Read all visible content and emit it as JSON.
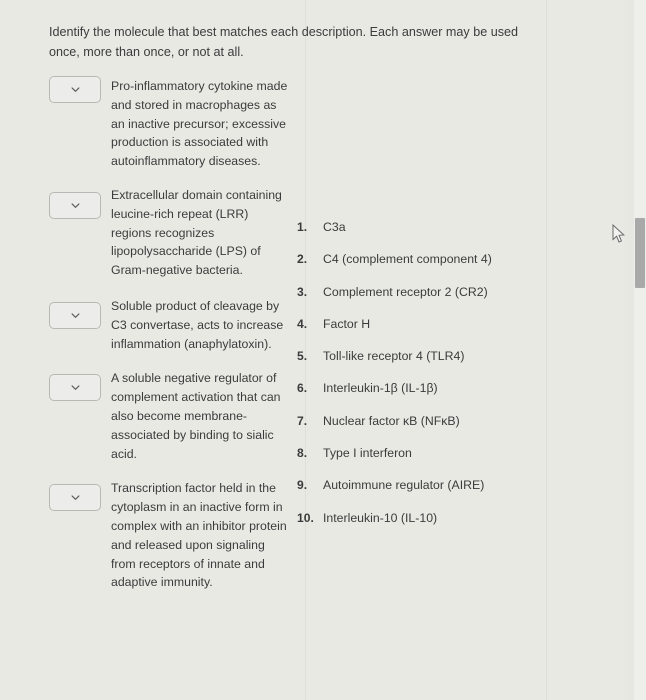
{
  "prompt": "Identify the molecule that best matches each description. Each answer may be used once, more than once, or not at all.",
  "dropdown_icon": "chevron-down-icon",
  "questions": [
    {
      "id": 1,
      "selected": "",
      "text": "Pro-inflammatory cytokine made and stored in macrophages as an inactive precursor; excessive production is associated with autoinflammatory diseases."
    },
    {
      "id": 2,
      "selected": "",
      "text": "Extracellular domain containing leucine-rich repeat (LRR) regions recognizes lipopolysaccharide (LPS) of Gram-negative bacteria."
    },
    {
      "id": 3,
      "selected": "",
      "text": "Soluble product of cleavage by C3 convertase, acts to increase inflammation (anaphylatoxin)."
    },
    {
      "id": 4,
      "selected": "",
      "text": "A soluble negative regulator of complement activation that can also become membrane-associated by binding to sialic acid."
    },
    {
      "id": 5,
      "selected": "",
      "text": "Transcription factor held in the cytoplasm in an inactive form in complex with an inhibitor protein and released upon signaling from receptors of innate and adaptive immunity."
    }
  ],
  "options": [
    {
      "num": "1.",
      "label": "C3a"
    },
    {
      "num": "2.",
      "label": "C4 (complement component 4)"
    },
    {
      "num": "3.",
      "label": "Complement receptor 2 (CR2)"
    },
    {
      "num": "4.",
      "label": "Factor H"
    },
    {
      "num": "5.",
      "label": "Toll-like receptor 4 (TLR4)"
    },
    {
      "num": "6.",
      "label": "Interleukin-1β (IL-1β)"
    },
    {
      "num": "7.",
      "label": "Nuclear factor κB (NFκB)"
    },
    {
      "num": "8.",
      "label": "Type I interferon"
    },
    {
      "num": "9.",
      "label": "Autoimmune regulator (AIRE)"
    },
    {
      "num": "10.",
      "label": "Interleukin-10 (IL-10)"
    }
  ],
  "colors": {
    "background": "#e9e9e4",
    "text": "#3b3b3b",
    "dropdown_border": "#b9b9b4",
    "dropdown_fill": "#ececea",
    "scrollbar_thumb": "#a9a9a9",
    "scrollbar_track": "#eeeeea"
  }
}
